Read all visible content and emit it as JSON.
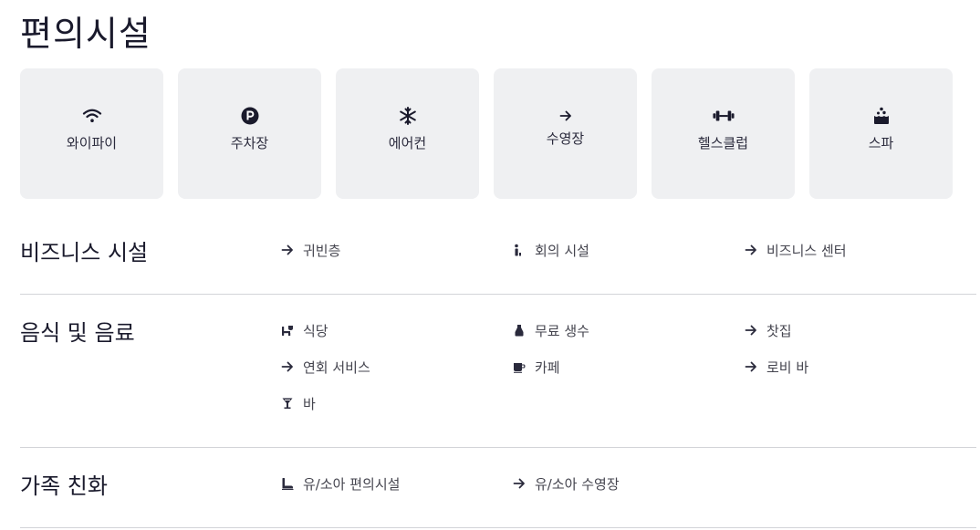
{
  "page_title": "편의시설",
  "tiles": [
    {
      "label": "와이파이",
      "icon": "wifi-icon"
    },
    {
      "label": "주차장",
      "icon": "parking-icon"
    },
    {
      "label": "에어컨",
      "icon": "snowflake-icon"
    },
    {
      "label": "수영장",
      "icon": "arrow-right-icon"
    },
    {
      "label": "헬스클럽",
      "icon": "dumbbell-icon"
    },
    {
      "label": "스파",
      "icon": "spa-icon"
    }
  ],
  "sections": [
    {
      "title": "비즈니스 시설",
      "items": [
        {
          "label": "귀빈층",
          "icon": "arrow-right-icon"
        },
        {
          "label": "회의 시설",
          "icon": "presenter-icon"
        },
        {
          "label": "비즈니스 센터",
          "icon": "arrow-right-icon"
        }
      ]
    },
    {
      "title": "음식 및 음료",
      "items": [
        {
          "label": "식당",
          "icon": "restaurant-icon"
        },
        {
          "label": "무료 생수",
          "icon": "water-bottle-icon"
        },
        {
          "label": "찻집",
          "icon": "arrow-right-icon"
        },
        {
          "label": "연회 서비스",
          "icon": "arrow-right-icon"
        },
        {
          "label": "카페",
          "icon": "coffee-cup-icon"
        },
        {
          "label": "로비 바",
          "icon": "arrow-right-icon"
        },
        {
          "label": "바",
          "icon": "cocktail-icon"
        }
      ]
    },
    {
      "title": "가족 친화",
      "items": [
        {
          "label": "유/소아 편의시설",
          "icon": "child-seat-icon"
        },
        {
          "label": "유/소아 수영장",
          "icon": "arrow-right-icon"
        }
      ]
    }
  ]
}
